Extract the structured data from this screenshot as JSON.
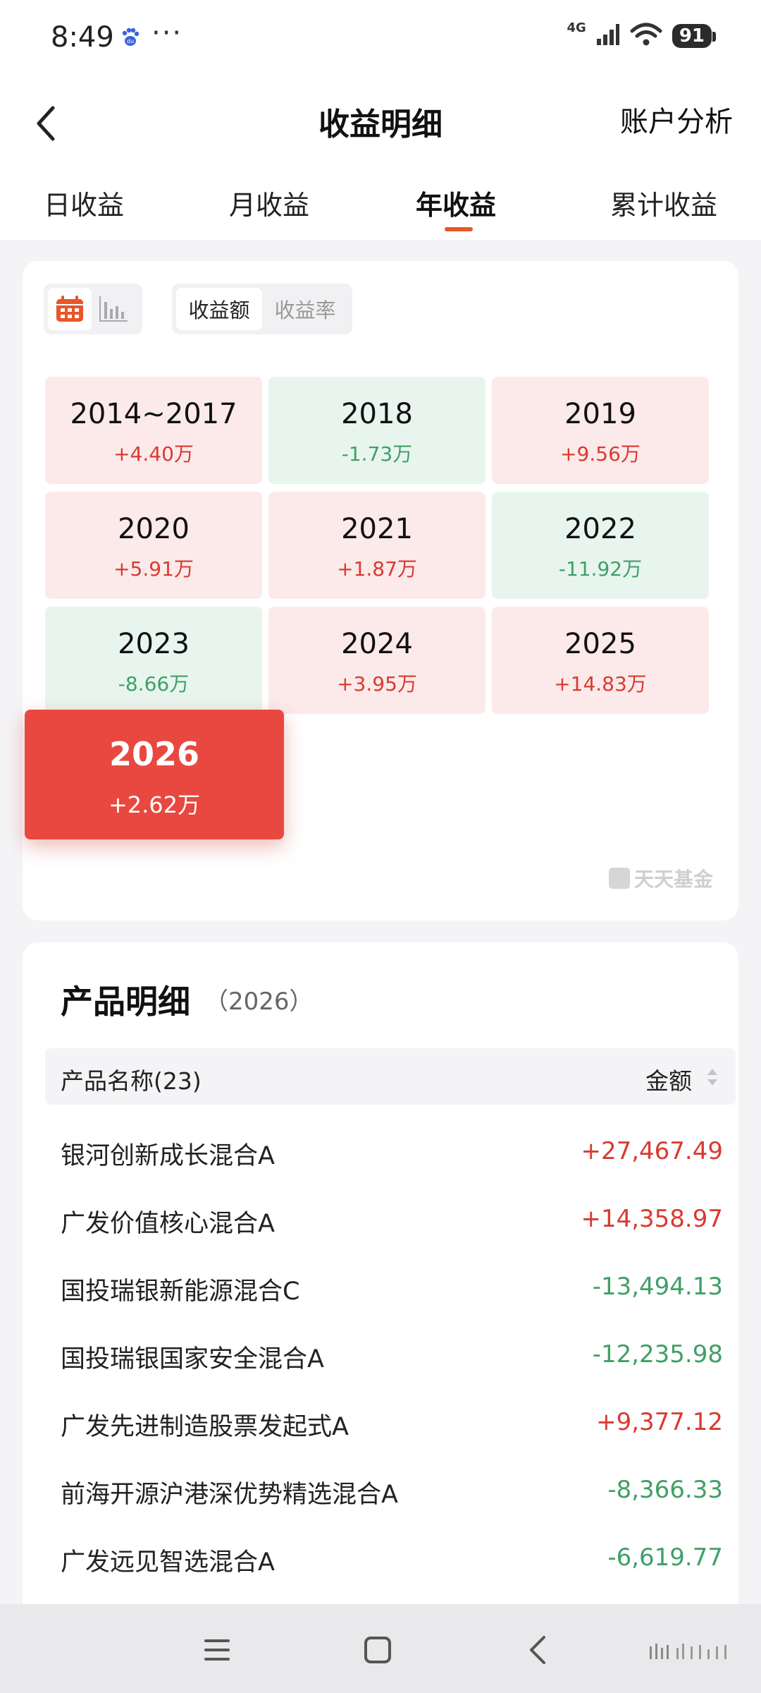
{
  "status_bar": {
    "time": "8:49",
    "network": "4G",
    "battery": "91",
    "app_icon": "baidu-paw-icon",
    "dots": "···"
  },
  "header": {
    "title": "收益明细",
    "right_link": "账户分析",
    "back_icon": "chevron-left-icon"
  },
  "tabs": [
    {
      "label": "日收益"
    },
    {
      "label": "月收益"
    },
    {
      "label": "年收益"
    },
    {
      "label": "累计收益"
    }
  ],
  "active_tab": "年收益",
  "view_toggle": {
    "options": [
      "calendar-icon",
      "bar-chart-icon"
    ],
    "active": "calendar-icon"
  },
  "metric_toggle": {
    "options": [
      "收益额",
      "收益率"
    ],
    "active": "收益额"
  },
  "years": [
    {
      "label": "2014~2017",
      "value": "+4.40万",
      "trend": "up"
    },
    {
      "label": "2018",
      "value": "-1.73万",
      "trend": "down"
    },
    {
      "label": "2019",
      "value": "+9.56万",
      "trend": "up"
    },
    {
      "label": "2020",
      "value": "+5.91万",
      "trend": "up"
    },
    {
      "label": "2021",
      "value": "+1.87万",
      "trend": "up"
    },
    {
      "label": "2022",
      "value": "-11.92万",
      "trend": "down"
    },
    {
      "label": "2023",
      "value": "-8.66万",
      "trend": "down"
    },
    {
      "label": "2024",
      "value": "+3.95万",
      "trend": "up"
    },
    {
      "label": "2025",
      "value": "+14.83万",
      "trend": "up"
    },
    {
      "label": "2026",
      "value": "+2.62万",
      "trend": "up",
      "selected": true
    }
  ],
  "watermark": {
    "text": "天天基金"
  },
  "products": {
    "title": "产品明细",
    "year": "（2026）",
    "header_name": "产品名称(23)",
    "header_amount": "金额",
    "rows": [
      {
        "name": "银河创新成长混合A",
        "amount": "+27,467.49",
        "trend": "up"
      },
      {
        "name": "广发价值核心混合A",
        "amount": "+14,358.97",
        "trend": "up"
      },
      {
        "name": "国投瑞银新能源混合C",
        "amount": "-13,494.13",
        "trend": "down"
      },
      {
        "name": "国投瑞银国家安全混合A",
        "amount": "-12,235.98",
        "trend": "down"
      },
      {
        "name": "广发先进制造股票发起式A",
        "amount": "+9,377.12",
        "trend": "up"
      },
      {
        "name": "前海开源沪港深优势精选混合A",
        "amount": "-8,366.33",
        "trend": "down"
      },
      {
        "name": "广发远见智选混合A",
        "amount": "-6,619.77",
        "trend": "down"
      }
    ]
  },
  "colors": {
    "accent": "#e8562a",
    "up": "#d93a30",
    "down": "#3fa066",
    "up_bg": "#fceaea",
    "down_bg": "#e8f5ee",
    "selected_bg": "#e8483f"
  }
}
